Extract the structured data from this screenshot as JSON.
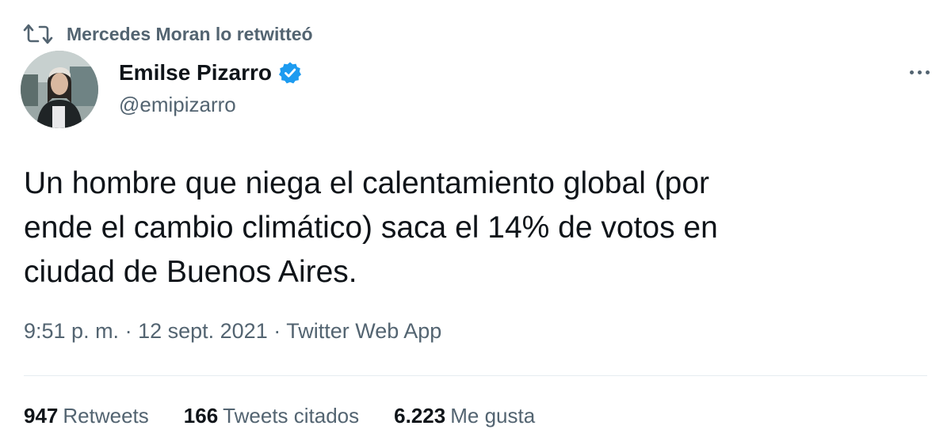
{
  "retweet_banner": {
    "text": "Mercedes Moran lo retwitteó",
    "icon": "retweet-icon"
  },
  "author": {
    "display_name": "Emilse Pizarro",
    "handle": "@emipizarro",
    "verified_icon": "verified-badge-icon",
    "verified_color": "#1d9bf0"
  },
  "more_icon": "more-options-icon",
  "tweet": {
    "text": "Un hombre que niega el calentamiento global (por\nende el cambio climático) saca el 14% de votos en\nciudad de Buenos Aires."
  },
  "meta": {
    "time": "9:51 p. m.",
    "separator": " · ",
    "date": "12 sept. 2021",
    "source": "Twitter Web App"
  },
  "stats": {
    "retweets_count": "947",
    "retweets_label": "Retweets",
    "quotes_count": "166",
    "quotes_label": "Tweets citados",
    "likes_count": "6.223",
    "likes_label": "Me gusta"
  },
  "colors": {
    "text_primary": "#0f1419",
    "text_secondary": "#536471",
    "divider": "#e6ecf0"
  }
}
